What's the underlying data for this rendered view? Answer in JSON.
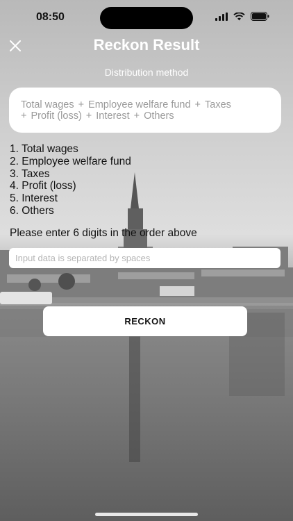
{
  "status_bar": {
    "time": "08:50"
  },
  "header": {
    "title": "Reckon Result",
    "close_icon": "close-icon"
  },
  "subtitle": "Distribution method",
  "formula": {
    "terms": [
      "Total wages",
      "Employee welfare fund",
      "Taxes",
      "Profit (loss)",
      "Interest",
      "Others"
    ],
    "operator": "+"
  },
  "method_list": [
    "1. Total wages",
    "2. Employee welfare fund",
    "3. Taxes",
    "4. Profit (loss)",
    "5. Interest",
    "6. Others"
  ],
  "instruction": "Please enter 6 digits in the order above",
  "input": {
    "value": "",
    "placeholder": "Input data is separated by spaces"
  },
  "reckon_button": {
    "label": "RECKON"
  }
}
